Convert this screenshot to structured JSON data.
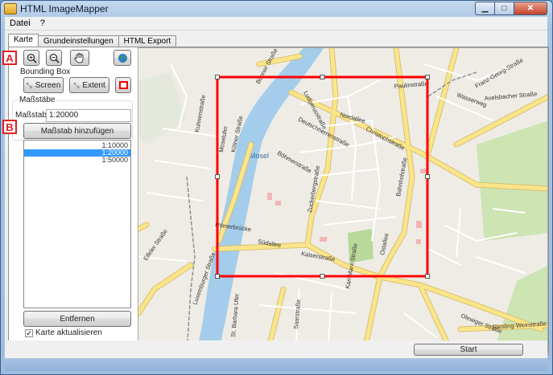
{
  "window": {
    "title": "HTML ImageMapper",
    "controls": [
      "minimize-icon",
      "maximize-icon",
      "close-icon"
    ]
  },
  "menu": [
    "Datei",
    "?"
  ],
  "tabs": [
    "Karte",
    "Grundeinstellungen",
    "HTML Export"
  ],
  "toolbar": {
    "zoom_in": "zoom-in-icon",
    "zoom_out": "zoom-out-icon",
    "pan": "hand-icon",
    "globe": "globe-icon"
  },
  "bounding_box": {
    "title": "Bounding Box",
    "screen_label": "Screen",
    "extent_label": "Extent"
  },
  "massstaebe": {
    "title": "Maßstäbe",
    "label": "Maßstab:",
    "value": "1:20000",
    "add_button": "Maßstab hinzufügen",
    "list": [
      "1:10000",
      "1:20000",
      "1:50000"
    ],
    "selected_index": 1,
    "remove_button": "Entfernen",
    "checkbox_label": "Karte aktualisieren",
    "checkbox_checked": true
  },
  "callouts": [
    "A",
    "B"
  ],
  "footer": {
    "start_button": "Start"
  },
  "map": {
    "river": "Mosel",
    "streets": [
      "Bonner Straße",
      "Kölner Straße",
      "Moselufer",
      "Ludgerusstraße",
      "Nordallee",
      "Deutschherrenstraße",
      "Christophstraße",
      "Paulinstraße",
      "Wasserweg",
      "Franz-Georg-Straße",
      "Avelsbacher Straße",
      "Böhmerstraße",
      "Zuckerbergstraße",
      "Bahnhofstraße",
      "Ostallee",
      "Römerbrücke",
      "Kaiserstraße",
      "Südallee",
      "Luxemburger Straße",
      "St. Barbara Ufer",
      "Olewiger Straße",
      "Riesling-Weinstraße",
      "Eifeler Straße",
      "Saarstraße",
      "Kuhnenstraße",
      "Karl-Marx-Straße"
    ],
    "colors": {
      "land": "#efece6",
      "river": "#a3cdea",
      "road": "#fbe58a",
      "road_edge": "#d7c070",
      "green": "#cde4b3",
      "bbox": "#ff0000",
      "building": "#f2b6b6"
    }
  }
}
